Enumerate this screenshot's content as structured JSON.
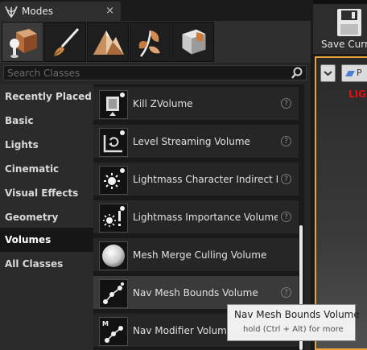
{
  "tab": {
    "title": "Modes",
    "close": "×"
  },
  "search": {
    "placeholder": "Search Classes",
    "value": ""
  },
  "categories": [
    {
      "label": "Recently Placed",
      "selected": false
    },
    {
      "label": "Basic",
      "selected": false
    },
    {
      "label": "Lights",
      "selected": false
    },
    {
      "label": "Cinematic",
      "selected": false
    },
    {
      "label": "Visual Effects",
      "selected": false
    },
    {
      "label": "Geometry",
      "selected": false
    },
    {
      "label": "Volumes",
      "selected": true
    },
    {
      "label": "All Classes",
      "selected": false
    }
  ],
  "items": [
    {
      "label": "Kill ZVolume",
      "icon": "kill-zvolume-icon",
      "help": "?"
    },
    {
      "label": "Level Streaming Volume",
      "icon": "level-streaming-icon",
      "help": "?"
    },
    {
      "label": "Lightmass Character Indirect Detail Volume",
      "icon": "lightmass-character-icon",
      "help": "?"
    },
    {
      "label": "Lightmass Importance Volume",
      "icon": "lightmass-importance-icon",
      "help": "?"
    },
    {
      "label": "Mesh Merge Culling Volume",
      "icon": "sphere-icon",
      "help": ""
    },
    {
      "label": "Nav Mesh Bounds Volume",
      "icon": "nav-mesh-icon",
      "help": "?"
    },
    {
      "label": "Nav Modifier Volume",
      "icon": "nav-modifier-icon",
      "help": ""
    }
  ],
  "tooltip": {
    "title": "Nav Mesh Bounds Volume",
    "hint": "hold (Ctrl + Alt) for more"
  },
  "toolbar": {
    "save_label": "Save Current"
  },
  "viewport": {
    "mode_label": "P",
    "warning": "LIGHTING NEEDS TO BE REBUILT"
  }
}
